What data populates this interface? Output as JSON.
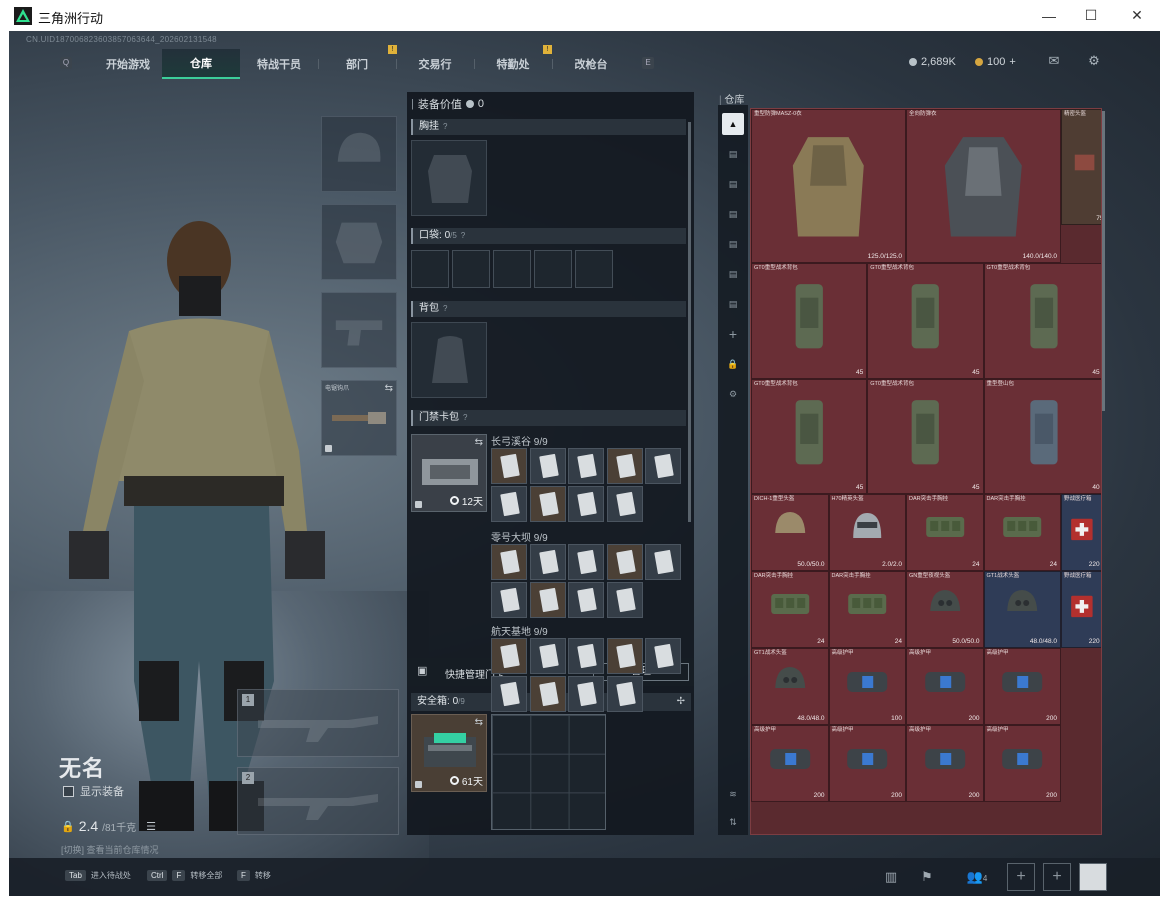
{
  "window": {
    "title": "三角洲行动"
  },
  "uid": "CN.UID18700682360385706364​4_202602131548",
  "nav": {
    "key_left": "Q",
    "key_right": "E",
    "tabs": [
      "开始游戏",
      "仓库",
      "特战干员",
      "部门",
      "交易行",
      "特勤处",
      "改枪台"
    ],
    "active_tab": "仓库",
    "badges": [
      "!",
      "!"
    ]
  },
  "currency": {
    "silver": "2,689K",
    "gold": "100",
    "gold_plus": "+"
  },
  "player": {
    "name": "无名",
    "show_equip_label": "显示装备",
    "weight": "2.4",
    "weight_max": "/81千克",
    "hint": "[切换] 查看当前仓库情况"
  },
  "loadout": {
    "melee_label": "电锯钩爪",
    "weapon_slot_1": "1",
    "weapon_slot_2": "2"
  },
  "middle": {
    "equip_value_label": "装备价值",
    "equip_value": "0",
    "chest_label": "胸挂",
    "pocket_label": "口袋:",
    "pocket_count": "0",
    "pocket_max": "/5",
    "backpack_label": "背包",
    "keycard_label": "门禁卡包",
    "keycase_timer": "12天",
    "maps": [
      {
        "name": "长弓溪谷",
        "count": "9/9"
      },
      {
        "name": "零号大坝",
        "count": "9/9"
      },
      {
        "name": "航天基地",
        "count": "9/9"
      }
    ],
    "quick_manage": "快捷管理门卡",
    "manage_button": "管理",
    "safe_label": "安全箱:",
    "safe_count": "0",
    "safe_max": "/9",
    "safe_timer": "61天"
  },
  "warehouse": {
    "label": "仓库",
    "items": [
      {
        "name": "重型防弹MASZ-0衣",
        "durability": "125.0/125.0"
      },
      {
        "name": "全向防弹衣",
        "durability": "140.0/140.0"
      },
      {
        "name": "精密头盔",
        "durability": "75"
      },
      {
        "name": "GT0重型战术背包",
        "count": "45"
      },
      {
        "name": "GT0重型战术背包",
        "count": "45"
      },
      {
        "name": "GT0重型战术背包",
        "count": "45"
      },
      {
        "name": "GT0重型战术背包",
        "count": "45"
      },
      {
        "name": "GT0重型战术背包",
        "count": "45"
      },
      {
        "name": "重型登山包",
        "count": "40"
      },
      {
        "name": "DICH-1重型头盔",
        "durability": "50.0/50.0"
      },
      {
        "name": "H70精英头盔",
        "durability": "2.0/2.0"
      },
      {
        "name": "DAR突击手胸挂",
        "count": "24"
      },
      {
        "name": "DAR突击手胸挂",
        "count": "24"
      },
      {
        "name": "野战医疗箱",
        "count": "220"
      },
      {
        "name": "DAR突击手胸挂",
        "count": "24"
      },
      {
        "name": "DAR突击手胸挂",
        "count": "24"
      },
      {
        "name": "GN重型夜视头盔",
        "durability": "50.0/50.0"
      },
      {
        "name": "GT1战术头盔",
        "durability": "48.0/48.0"
      },
      {
        "name": "野战医疗箱",
        "count": "220"
      },
      {
        "name": "GT1战术头盔",
        "durability": "48.0/48.0"
      },
      {
        "name": "高级护甲",
        "count": "100"
      },
      {
        "name": "高级护甲",
        "count": "200"
      },
      {
        "name": "高级护甲",
        "count": "200"
      },
      {
        "name": "高级护甲",
        "count": "200"
      },
      {
        "name": "高级护甲",
        "count": "200"
      },
      {
        "name": "高级护甲",
        "count": "200"
      },
      {
        "name": "高级护甲",
        "count": "200"
      }
    ]
  },
  "footer": {
    "k1": "Tab",
    "k1_label": "进入待战处",
    "k2": "Ctrl",
    "k2b": "F",
    "k2_label": "转移全部",
    "k3": "F",
    "k3_label": "转移",
    "party_count": "4"
  }
}
